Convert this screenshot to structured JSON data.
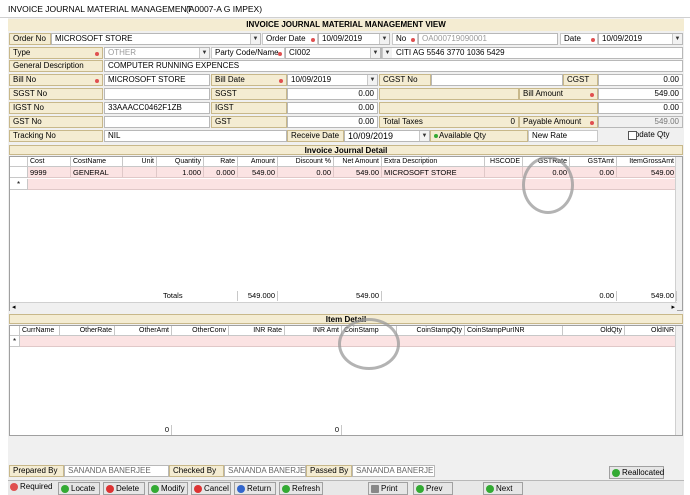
{
  "window": {
    "title": "INVOICE JOURNAL MATERIAL MANAGEMENT",
    "subtitle": "(A0007-A G IMPEX)",
    "banner": "INVOICE JOURNAL MATERIAL MANAGEMENT VIEW"
  },
  "header": {
    "order_no_label": "Order No",
    "order_no": "MICROSOFT STORE",
    "order_date_label": "Order Date",
    "order_date": "10/09/2019",
    "no_label": "No",
    "no": "OA000719090001",
    "date_label": "Date",
    "date": "10/09/2019",
    "type_label": "Type",
    "type": "OTHER",
    "party_label": "Party Code/Name",
    "party_code": "CI002",
    "party_name": "CITI AG 5546 3770 1036 5429",
    "gen_desc_label": "General Description",
    "gen_desc": "COMPUTER RUNNING EXPENCES",
    "bill_no_label": "Bill No",
    "bill_no": "MICROSOFT STORE",
    "bill_date_label": "Bill Date",
    "bill_date": "10/09/2019",
    "cgst_no_label": "CGST No",
    "cgst_label": "CGST",
    "cgst": "0.00",
    "sgst_no_label": "SGST No",
    "sgst_label": "SGST",
    "sgst": "0.00",
    "bill_amount_label": "Bill Amount",
    "bill_amount": "549.00",
    "igst_no_label": "IGST No",
    "igst_no": "33AAACC0462F1ZB",
    "igst_label": "IGST",
    "igst": "0.00",
    "igst_right": "0.00",
    "gst_no_label": "GST No",
    "gst_label": "GST",
    "gst": "0.00",
    "total_taxes_label": "Total Taxes",
    "total_taxes": "0",
    "payable_label": "Payable Amount",
    "payable": "549.00",
    "tracking_label": "Tracking No",
    "tracking": "NIL",
    "receive_date_label": "Receive Date",
    "receive_date": "10/09/2019",
    "avail_qty_label": "Available Qty",
    "new_rate_label": "New Rate",
    "update_qty_label": "Update Qty"
  },
  "invoice_detail": {
    "title": "Invoice Journal Detail",
    "columns": [
      "Cost",
      "CostName",
      "Unit",
      "Quantity",
      "Rate",
      "Amount",
      "Discount %",
      "Net Amount",
      "Extra Description",
      "HSCODE",
      "GSTRate",
      "GSTAmt",
      "ItemGrossAmt"
    ],
    "row": [
      "9999",
      "GENERAL",
      "",
      "1.000",
      "0.000",
      "549.00",
      "0.00",
      "549.00",
      "MICROSOFT STORE",
      "",
      "0.00",
      "0.00",
      "549.00"
    ],
    "totals_label": "Totals",
    "total_amount": "549.000",
    "total_net": "549.00",
    "total_gstamt": "0.00",
    "total_gross": "549.00"
  },
  "item_detail": {
    "title": "Item Detail",
    "columns": [
      "CurrName",
      "OtherRate",
      "OtherAmt",
      "OtherConv",
      "INR Rate",
      "INR Amt",
      "CoinStamp",
      "CoinStampQty",
      "CoinStampPurINR",
      "OldQty",
      "OldINR"
    ],
    "total_a": "0",
    "total_b": "0"
  },
  "footer": {
    "prepared_label": "Prepared By",
    "prepared": "SANANDA BANERJEE",
    "checked_label": "Checked By",
    "checked": "SANANDA BANERJEE",
    "passed_label": "Passed By",
    "passed": "SANANDA BANERJEE",
    "reallocated": "Reallocated"
  },
  "toolbar": {
    "required": "Required",
    "locate": "Locate",
    "delete": "Delete",
    "modify": "Modify",
    "cancel": "Cancel",
    "return": "Return",
    "refresh": "Refresh",
    "print": "Print",
    "prev": "Prev",
    "next": "Next"
  }
}
